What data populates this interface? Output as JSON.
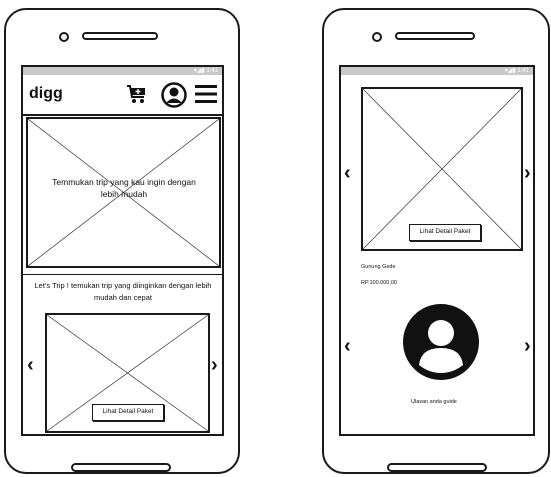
{
  "left_phone": {
    "brand": "digg",
    "hero_text": "Temmukan trip yang kau ingin dengan lebih mudah",
    "tagline": "Let's Trip ! temukan trip yang diinginkan dengan lebih mudah dan cepat",
    "card_button": "Lihat Detail Paket",
    "prev_arrow": "‹",
    "next_arrow": "›"
  },
  "right_phone": {
    "card_button": "Lihat Detail Paket",
    "item_name": "Gunung Gede",
    "item_price": "RP.100.000,00",
    "guide_caption": "Ulasan anda guide",
    "prev_arrow": "‹",
    "next_arrow": "›"
  },
  "icons": [
    "cart-icon",
    "profile-icon",
    "hamburger-menu-icon",
    "user-avatar-icon"
  ]
}
